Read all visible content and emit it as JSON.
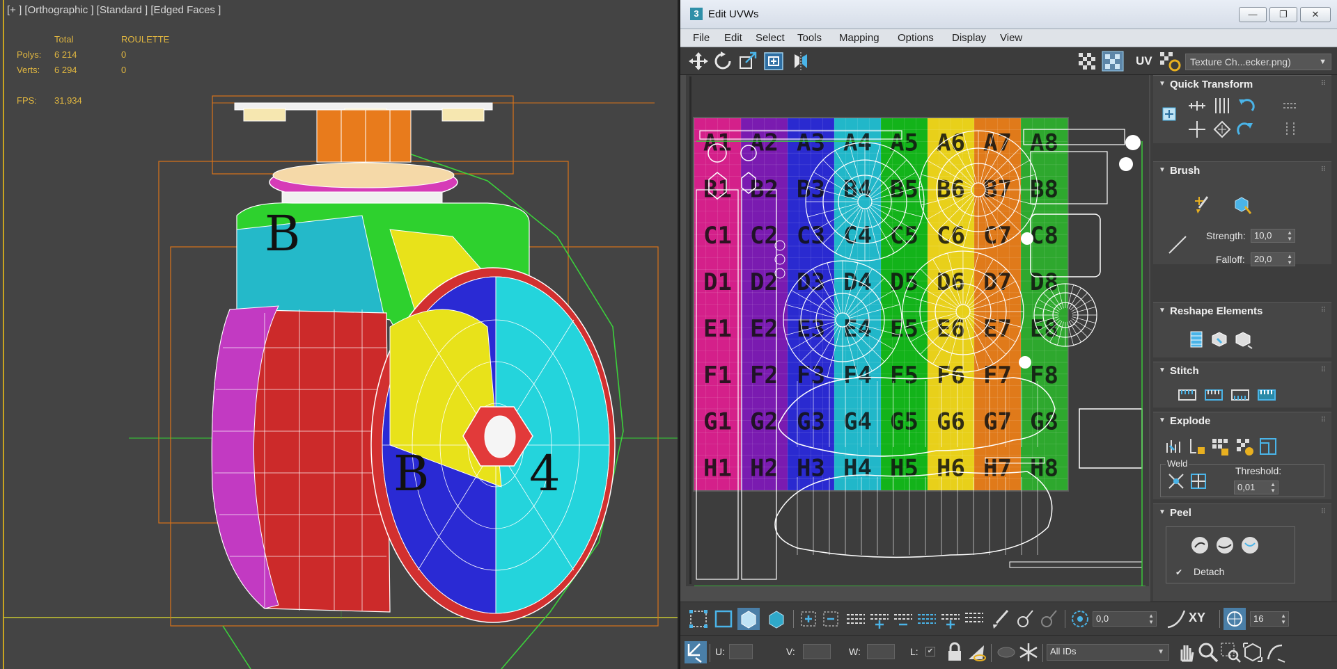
{
  "viewport": {
    "label": "[+ ] [Orthographic ] [Standard ] [Edged Faces ]",
    "stats": {
      "col_total": "Total",
      "col_object": "ROULETTE",
      "polys_label": "Polys:",
      "polys_total": "6 214",
      "polys_object": "0",
      "verts_label": "Verts:",
      "verts_total": "6 294",
      "verts_object": "0",
      "fps_label": "FPS:",
      "fps_value": "31,934"
    }
  },
  "uv_editor": {
    "app_icon": "3",
    "title": "Edit UVWs",
    "window_buttons": {
      "minimize": "—",
      "maximize": "❐",
      "close": "✕"
    },
    "menu": [
      "File",
      "Edit",
      "Select",
      "Tools",
      "Mapping",
      "Options",
      "Display",
      "View"
    ],
    "toolbar": {
      "icons": [
        "move-icon",
        "rotate-icon",
        "scale-icon",
        "freeform-icon",
        "mirror-icon"
      ],
      "uv_label": "UV",
      "texture_dropdown": "Texture Ch...ecker.png)"
    },
    "checker_labels": [
      [
        "A1",
        "A2",
        "A3",
        "A4",
        "A5",
        "A6",
        "A7",
        "A8"
      ],
      [
        "B1",
        "B2",
        "B3",
        "B4",
        "B5",
        "B6",
        "B7",
        "B8"
      ],
      [
        "C1",
        "C2",
        "C3",
        "C4",
        "C5",
        "C6",
        "C7",
        "C8"
      ],
      [
        "D1",
        "D2",
        "D3",
        "D4",
        "D5",
        "D6",
        "D7",
        "D8"
      ],
      [
        "E1",
        "E2",
        "E3",
        "E4",
        "E5",
        "E6",
        "E7",
        "E8"
      ],
      [
        "F1",
        "F2",
        "F3",
        "F4",
        "F5",
        "F6",
        "F7",
        "F8"
      ],
      [
        "G1",
        "G2",
        "G3",
        "G4",
        "G5",
        "G6",
        "G7",
        "G8"
      ],
      [
        "H1",
        "H2",
        "H3",
        "H4",
        "H5",
        "H6",
        "H7",
        "H8"
      ]
    ],
    "checker_colors": [
      "#c8102e",
      "#d4208a",
      "#7a1bb0",
      "#2a2ad0",
      "#21b7c9",
      "#13b31a",
      "#e8d01a",
      "#e07a1a",
      "#2ea82e"
    ],
    "panel": {
      "quick_transform": {
        "title": "Quick Transform"
      },
      "brush": {
        "title": "Brush",
        "strength_label": "Strength:",
        "strength_value": "10,0",
        "falloff_label": "Falloff:",
        "falloff_value": "20,0"
      },
      "reshape": {
        "title": "Reshape Elements"
      },
      "stitch": {
        "title": "Stitch"
      },
      "explode": {
        "title": "Explode",
        "weld_label": "Weld",
        "threshold_label": "Threshold:",
        "threshold_value": "0,01"
      },
      "peel": {
        "title": "Peel",
        "detach_label": "Detach",
        "detach_checked": true
      }
    },
    "bottom_bar_1": {
      "angle_value": "0,0",
      "xy_label": "XY",
      "grid_value": "16"
    },
    "bottom_bar_2": {
      "u_label": "U:",
      "v_label": "V:",
      "w_label": "W:",
      "l_label": "L:",
      "ids_dropdown": "All IDs"
    }
  }
}
